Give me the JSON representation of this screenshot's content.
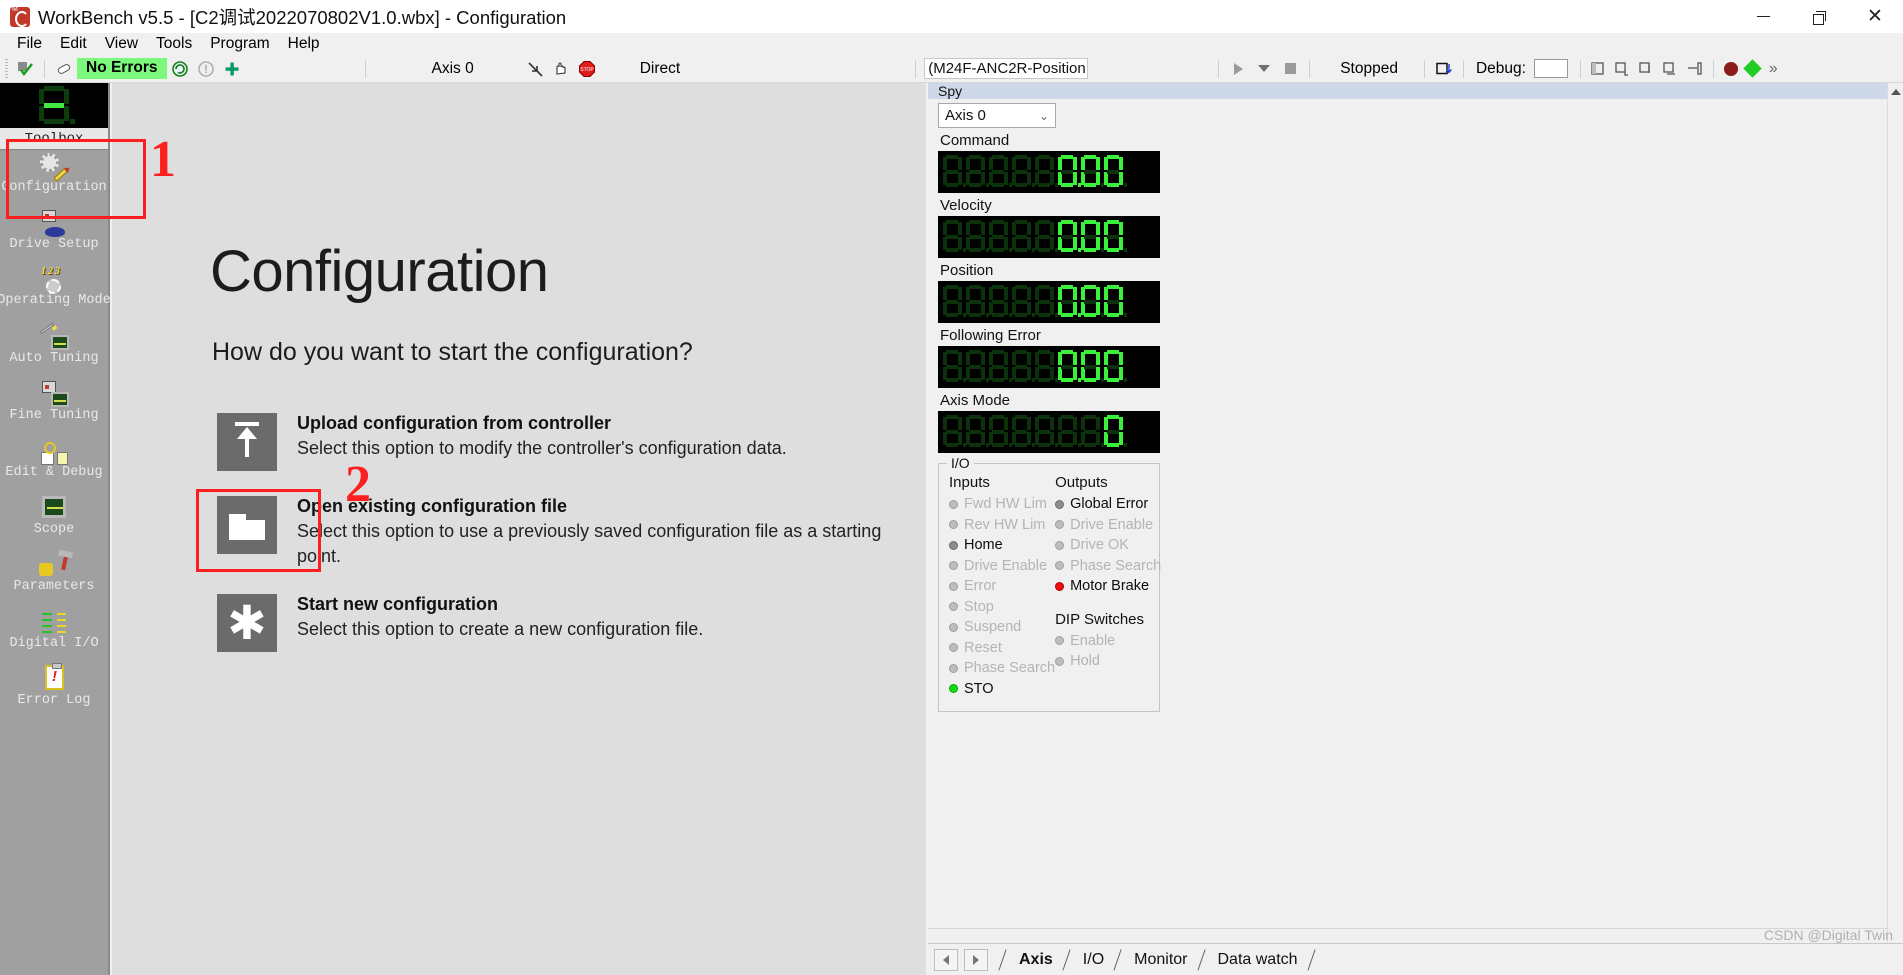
{
  "window": {
    "title": "WorkBench v5.5 - [C2调试2022070802V1.0.wbx] - Configuration",
    "logo_icon": "workbench-logo-icon",
    "minimize_icon": "minimize-icon",
    "maximize_icon": "maximize-icon",
    "close_icon": "close-icon"
  },
  "menu": {
    "items": [
      {
        "label": "File"
      },
      {
        "label": "Edit"
      },
      {
        "label": "View"
      },
      {
        "label": "Tools"
      },
      {
        "label": "Program"
      },
      {
        "label": "Help"
      }
    ]
  },
  "toolbar": {
    "compile_icon": "compile-check-icon",
    "clear_icon": "eraser-icon",
    "error_status": "No Errors",
    "error_status_bg": "#7cf87c",
    "refresh_icon": "refresh-circle-icon",
    "info_icon": "info-circle-icon",
    "add_icon": "plus-icon",
    "axis_label": "Axis 0",
    "jog_icon": "jog-arrow-icon",
    "hand_icon": "hand-icon",
    "stop_icon": "stop-sign-icon",
    "mode_label": "Direct",
    "program_combo_value": "(M24F-ANC2R-Position",
    "program_combo_icon": "list-icon",
    "run_icon": "run-play-icon",
    "run_dropdown_icon": "chevron-down-icon",
    "stop_square_icon": "stop-square-icon",
    "run_status": "Stopped",
    "window_layout_icon": "window-layout-icon",
    "debug_label": "Debug:",
    "debug_value": "",
    "step_icons": [
      "debug-step-1-icon",
      "debug-step-over-icon",
      "debug-step-into-icon",
      "debug-step-out-icon",
      "debug-run-to-cursor-icon"
    ],
    "record_icon": "record-dot-icon",
    "diamond_icon": "diamond-green-icon",
    "overflow_icon": "toolbar-overflow-icon"
  },
  "sidebar": {
    "caption": "Toolbox",
    "seven_segment_display": "8",
    "items": [
      {
        "label": "Configuration",
        "icon": "configuration-gear-pencil-icon",
        "name": "configuration"
      },
      {
        "label": "Drive Setup",
        "icon": "drive-setup-icon",
        "name": "drive-setup"
      },
      {
        "label": "Operating Mode",
        "icon": "operating-mode-icon",
        "name": "operating-mode"
      },
      {
        "label": "Auto Tuning",
        "icon": "auto-tuning-wand-icon",
        "name": "auto-tuning"
      },
      {
        "label": "Fine Tuning",
        "icon": "fine-tuning-icon",
        "name": "fine-tuning"
      },
      {
        "label": "Edit & Debug",
        "icon": "edit-debug-magnifier-icon",
        "name": "edit-debug"
      },
      {
        "label": "Scope",
        "icon": "scope-oscilloscope-icon",
        "name": "scope"
      },
      {
        "label": "Parameters",
        "icon": "parameters-hammer-icon",
        "name": "parameters"
      },
      {
        "label": "Digital I/O",
        "icon": "digital-io-icon",
        "name": "digital-io"
      },
      {
        "label": "Error Log",
        "icon": "error-log-clipboard-icon",
        "name": "error-log"
      }
    ]
  },
  "main": {
    "title": "Configuration",
    "subtitle": "How do you want to start the configuration?",
    "options": [
      {
        "heading": "Upload configuration from controller",
        "description": "Select this option to modify the controller's configuration data.",
        "icon": "upload-arrow-icon"
      },
      {
        "heading": "Open existing configuration file",
        "description": "Select this option to use a previously saved configuration file as a starting point.",
        "icon": "open-folder-icon"
      },
      {
        "heading": "Start new configuration",
        "description": "Select this option to create a new configuration file.",
        "icon": "asterisk-new-icon"
      }
    ]
  },
  "annotations": {
    "marker_color": "#fc1f1f",
    "items": [
      {
        "number": "1",
        "target": "sidebar-item-configuration"
      },
      {
        "number": "2",
        "target": "option-upload-configuration-icon"
      }
    ]
  },
  "spy": {
    "caption": "Spy",
    "axis_select_value": "Axis 0",
    "axis_select_icon": "chevron-down-icon",
    "readouts": [
      {
        "label": "Command",
        "value": "0.00",
        "digits": 8,
        "lit": "0.00"
      },
      {
        "label": "Velocity",
        "value": "0.00",
        "digits": 8,
        "lit": "0.00"
      },
      {
        "label": "Position",
        "value": "0.00",
        "digits": 8,
        "lit": "0.00"
      },
      {
        "label": "Following Error",
        "value": "0.00",
        "digits": 8,
        "lit": "0.00"
      },
      {
        "label": "Axis Mode",
        "value": "0",
        "digits": 8,
        "lit": "0"
      }
    ],
    "io": {
      "legend": "I/O",
      "inputs_header": "Inputs",
      "outputs_header": "Outputs",
      "dip_header": "DIP Switches",
      "inputs": [
        {
          "label": "Fwd HW Lim",
          "state": "off"
        },
        {
          "label": "Rev HW Lim",
          "state": "off"
        },
        {
          "label": "Home",
          "state": "gray"
        },
        {
          "label": "Drive Enable",
          "state": "off"
        },
        {
          "label": "Error",
          "state": "off"
        },
        {
          "label": "Stop",
          "state": "off"
        },
        {
          "label": "Suspend",
          "state": "off"
        },
        {
          "label": "Reset",
          "state": "off"
        },
        {
          "label": "Phase Search",
          "state": "off"
        },
        {
          "label": "STO",
          "state": "green"
        }
      ],
      "outputs": [
        {
          "label": "Global Error",
          "state": "gray"
        },
        {
          "label": "Drive Enable",
          "state": "off"
        },
        {
          "label": "Drive OK",
          "state": "off"
        },
        {
          "label": "Phase Search",
          "state": "off"
        },
        {
          "label": "Motor Brake",
          "state": "red"
        }
      ],
      "dip_switches": [
        {
          "label": "Enable",
          "state": "off"
        },
        {
          "label": "Hold",
          "state": "off"
        }
      ]
    }
  },
  "bottom_tabs": {
    "prev_icon": "tab-prev-icon",
    "next_icon": "tab-next-icon",
    "tabs": [
      {
        "label": "Axis",
        "active": true
      },
      {
        "label": "I/O",
        "active": false
      },
      {
        "label": "Monitor",
        "active": false
      },
      {
        "label": "Data watch",
        "active": false
      }
    ]
  },
  "watermark": "CSDN @Digital Twin"
}
